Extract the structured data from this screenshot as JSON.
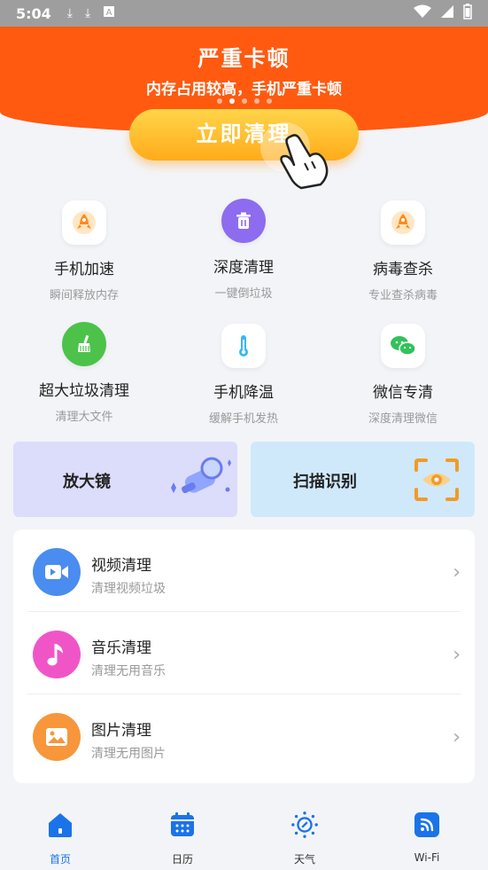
{
  "status_bar": {
    "time": "5:04"
  },
  "hero": {
    "title": "严重卡顿",
    "subtitle": "内存占用较高，手机严重卡顿",
    "cta_label": "立即清理",
    "carousel_count": 5,
    "carousel_active": 2
  },
  "features": [
    {
      "name": "手机加速",
      "desc": "瞬间释放内存",
      "icon": "rocket-icon"
    },
    {
      "name": "深度清理",
      "desc": "一键倒垃圾",
      "icon": "trash-icon"
    },
    {
      "name": "病毒查杀",
      "desc": "专业查杀病毒",
      "icon": "shield-icon"
    },
    {
      "name": "超大垃圾清理",
      "desc": "清理大文件",
      "icon": "broom-icon"
    },
    {
      "name": "手机降温",
      "desc": "缓解手机发热",
      "icon": "thermometer-icon"
    },
    {
      "name": "微信专清",
      "desc": "深度清理微信",
      "icon": "wechat-icon"
    }
  ],
  "cards": {
    "magnifier": {
      "label": "放大镜",
      "icon": "magnifier-icon"
    },
    "scan": {
      "label": "扫描识别",
      "icon": "scan-eye-icon"
    }
  },
  "list": [
    {
      "title": "视频清理",
      "subtitle": "清理视频垃圾",
      "icon": "video-icon",
      "color": "#4a8cf0"
    },
    {
      "title": "音乐清理",
      "subtitle": "清理无用音乐",
      "icon": "music-icon",
      "color": "#f055c8"
    },
    {
      "title": "图片清理",
      "subtitle": "清理无用图片",
      "icon": "image-icon",
      "color": "#f7963a"
    }
  ],
  "nav": [
    {
      "label": "首页",
      "icon": "home-icon",
      "active": true
    },
    {
      "label": "日历",
      "icon": "calendar-icon",
      "active": false
    },
    {
      "label": "天气",
      "icon": "weather-icon",
      "active": false
    },
    {
      "label": "Wi-Fi",
      "icon": "wifi-icon",
      "active": false
    }
  ],
  "colors": {
    "hero": "#ff5a10",
    "accent": "#1a73e8",
    "cta": "#ffb526"
  }
}
